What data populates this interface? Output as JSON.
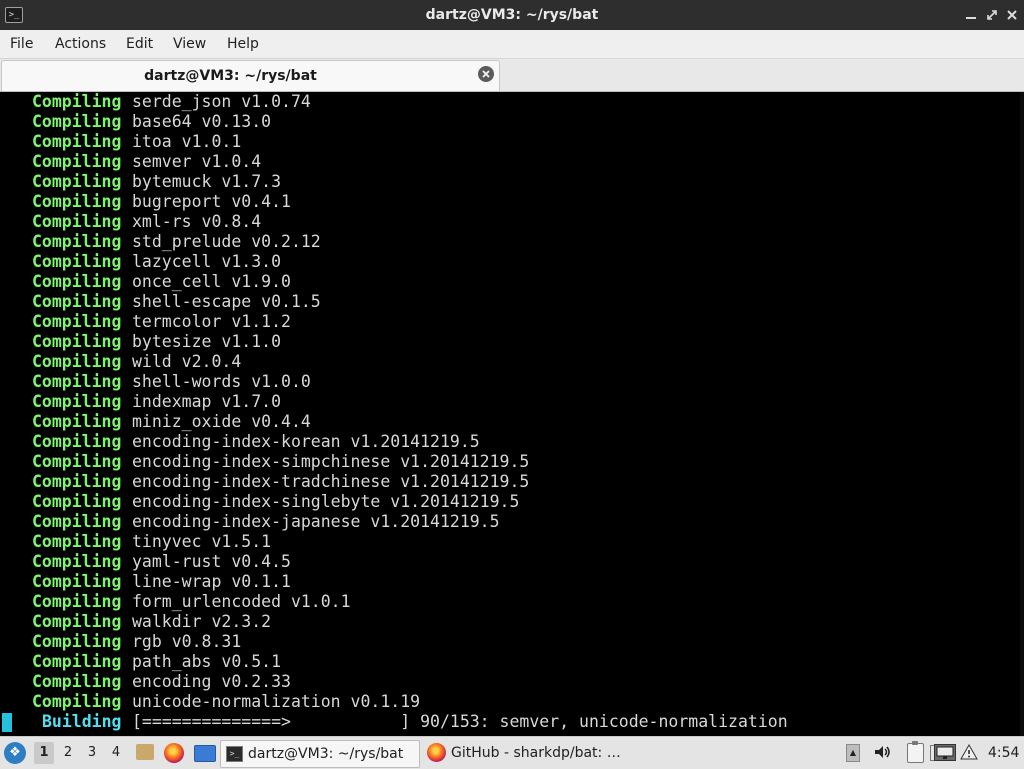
{
  "window": {
    "app_icon": ">_",
    "title": "dartz@VM3: ~/rys/bat",
    "minimize_glyph": "✕",
    "maximize_glyph": "⤡",
    "close_glyph": "✕"
  },
  "menubar": {
    "items": [
      "File",
      "Actions",
      "Edit",
      "View",
      "Help"
    ]
  },
  "tabs": [
    {
      "label": "dartz@VM3: ~/rys/bat",
      "close_glyph": "✕"
    }
  ],
  "terminal": {
    "lines": [
      {
        "verb": "Compiling",
        "crate": "serde_json v1.0.74"
      },
      {
        "verb": "Compiling",
        "crate": "base64 v0.13.0"
      },
      {
        "verb": "Compiling",
        "crate": "itoa v1.0.1"
      },
      {
        "verb": "Compiling",
        "crate": "semver v1.0.4"
      },
      {
        "verb": "Compiling",
        "crate": "bytemuck v1.7.3"
      },
      {
        "verb": "Compiling",
        "crate": "bugreport v0.4.1"
      },
      {
        "verb": "Compiling",
        "crate": "xml-rs v0.8.4"
      },
      {
        "verb": "Compiling",
        "crate": "std_prelude v0.2.12"
      },
      {
        "verb": "Compiling",
        "crate": "lazycell v1.3.0"
      },
      {
        "verb": "Compiling",
        "crate": "once_cell v1.9.0"
      },
      {
        "verb": "Compiling",
        "crate": "shell-escape v0.1.5"
      },
      {
        "verb": "Compiling",
        "crate": "termcolor v1.1.2"
      },
      {
        "verb": "Compiling",
        "crate": "bytesize v1.1.0"
      },
      {
        "verb": "Compiling",
        "crate": "wild v2.0.4"
      },
      {
        "verb": "Compiling",
        "crate": "shell-words v1.0.0"
      },
      {
        "verb": "Compiling",
        "crate": "indexmap v1.7.0"
      },
      {
        "verb": "Compiling",
        "crate": "miniz_oxide v0.4.4"
      },
      {
        "verb": "Compiling",
        "crate": "encoding-index-korean v1.20141219.5"
      },
      {
        "verb": "Compiling",
        "crate": "encoding-index-simpchinese v1.20141219.5"
      },
      {
        "verb": "Compiling",
        "crate": "encoding-index-tradchinese v1.20141219.5"
      },
      {
        "verb": "Compiling",
        "crate": "encoding-index-singlebyte v1.20141219.5"
      },
      {
        "verb": "Compiling",
        "crate": "encoding-index-japanese v1.20141219.5"
      },
      {
        "verb": "Compiling",
        "crate": "tinyvec v1.5.1"
      },
      {
        "verb": "Compiling",
        "crate": "yaml-rust v0.4.5"
      },
      {
        "verb": "Compiling",
        "crate": "line-wrap v0.1.1"
      },
      {
        "verb": "Compiling",
        "crate": "form_urlencoded v1.0.1"
      },
      {
        "verb": "Compiling",
        "crate": "walkdir v2.3.2"
      },
      {
        "verb": "Compiling",
        "crate": "rgb v0.8.31"
      },
      {
        "verb": "Compiling",
        "crate": "path_abs v0.5.1"
      },
      {
        "verb": "Compiling",
        "crate": "encoding v0.2.33"
      },
      {
        "verb": "Compiling",
        "crate": "unicode-normalization v0.1.19"
      }
    ],
    "building": {
      "verb": "Building",
      "status": "[==============>           ] 90/153: semver, unicode-normalization",
      "progress_current": 90,
      "progress_total": 153
    }
  },
  "taskbar": {
    "start_icon": "❖",
    "workspaces": [
      "1",
      "2",
      "3",
      "4"
    ],
    "active_workspace": "1",
    "launchers": [
      "files-icon",
      "firefox-icon",
      "desktop-icon"
    ],
    "tasks": [
      {
        "label": "dartz@VM3: ~/rys/bat",
        "icon": ">_",
        "active": true
      },
      {
        "label": "GitHub - sharkdp/bat: …",
        "icon": "firefox-icon",
        "active": false
      }
    ],
    "tray": {
      "up_glyph": "▲",
      "volume_glyph": "🔊",
      "network_glyph": "▭",
      "update_glyph": "⚠"
    },
    "clock": "4:54"
  }
}
